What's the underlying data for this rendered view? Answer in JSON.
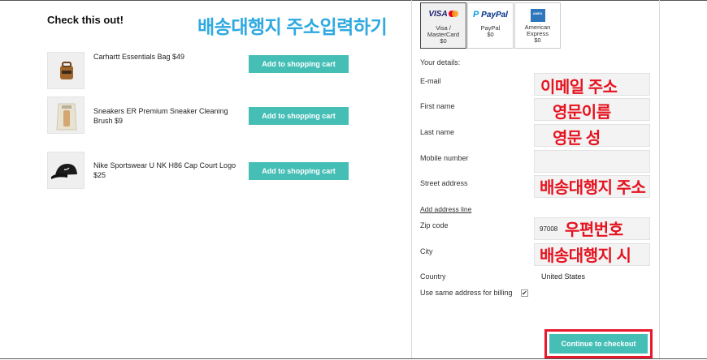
{
  "recommendations": {
    "title": "Check this out!",
    "annotation": "배송대행지 주소입력하기",
    "items": [
      {
        "name": "Carhartt Essentials Bag $49",
        "button": "Add to shopping cart",
        "icon": "bag-icon"
      },
      {
        "name": "Sneakers ER Premium Sneaker Cleaning Brush $9",
        "button": "Add to shopping cart",
        "icon": "brush-icon"
      },
      {
        "name": "Nike Sportswear U NK H86 Cap Court Logo $25",
        "button": "Add to shopping cart",
        "icon": "cap-icon"
      }
    ]
  },
  "payment": {
    "methods": [
      {
        "brand": "VISA",
        "label_line1": "Visa /",
        "label_line2": "MasterCard",
        "price": "$0",
        "selected": true
      },
      {
        "brand": "PayPal",
        "label_line1": "PayPal",
        "label_line2": "",
        "price": "$0",
        "selected": false
      },
      {
        "brand": "AMEX",
        "label_line1": "American",
        "label_line2": "Express",
        "price": "$0",
        "selected": false
      }
    ]
  },
  "details": {
    "heading": "Your details:",
    "fields": {
      "email": {
        "label": "E-mail",
        "value": "",
        "annotation": "이메일 주소"
      },
      "first_name": {
        "label": "First name",
        "value": "",
        "annotation": "영문이름"
      },
      "last_name": {
        "label": "Last name",
        "value": "",
        "annotation": "영문 성"
      },
      "mobile": {
        "label": "Mobile number",
        "value": ""
      },
      "street": {
        "label": "Street address",
        "value": "",
        "annotation": "배송대행지 주소"
      },
      "zip": {
        "label": "Zip code",
        "value": "97008",
        "annotation": "우편번호"
      },
      "city": {
        "label": "City",
        "value": "",
        "annotation": "배송대행지 시"
      },
      "country": {
        "label": "Country",
        "value": "United States"
      }
    },
    "add_address_line": "Add address line",
    "billing_same": {
      "label": "Use same address for billing",
      "checked": true,
      "mark": "✔"
    }
  },
  "checkout": {
    "label": "Continue to checkout"
  },
  "colors": {
    "accent": "#45bfb6",
    "annotation_red": "#e5121f",
    "annotation_blue": "#2fa9e0"
  }
}
